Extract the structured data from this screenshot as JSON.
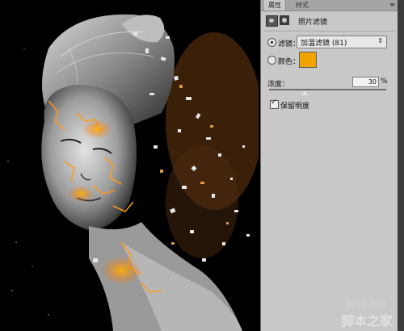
{
  "panel": {
    "tabs": [
      "属性",
      "样式"
    ],
    "adjustment_title": "照片滤镜",
    "filter_label": "滤镜：",
    "filter_value": "加温滤镜 (81)",
    "color_label": "颜色：",
    "color_swatch": "#f0a400",
    "density_label": "浓度：",
    "density_value": "30",
    "density_unit": "%",
    "density_level_percent": 30,
    "preserve_luminosity_label": "保留明度",
    "preserve_luminosity_checked": true
  },
  "watermark": {
    "site": "jb51.net",
    "brand": "脚本之家"
  }
}
